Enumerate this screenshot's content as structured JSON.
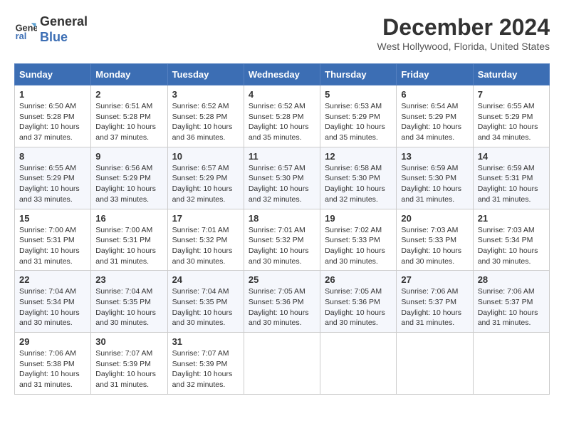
{
  "logo": {
    "line1": "General",
    "line2": "Blue"
  },
  "title": "December 2024",
  "location": "West Hollywood, Florida, United States",
  "days_of_week": [
    "Sunday",
    "Monday",
    "Tuesday",
    "Wednesday",
    "Thursday",
    "Friday",
    "Saturday"
  ],
  "weeks": [
    [
      {
        "day": "1",
        "sunrise": "6:50 AM",
        "sunset": "5:28 PM",
        "daylight": "10 hours and 37 minutes."
      },
      {
        "day": "2",
        "sunrise": "6:51 AM",
        "sunset": "5:28 PM",
        "daylight": "10 hours and 37 minutes."
      },
      {
        "day": "3",
        "sunrise": "6:52 AM",
        "sunset": "5:28 PM",
        "daylight": "10 hours and 36 minutes."
      },
      {
        "day": "4",
        "sunrise": "6:52 AM",
        "sunset": "5:28 PM",
        "daylight": "10 hours and 35 minutes."
      },
      {
        "day": "5",
        "sunrise": "6:53 AM",
        "sunset": "5:29 PM",
        "daylight": "10 hours and 35 minutes."
      },
      {
        "day": "6",
        "sunrise": "6:54 AM",
        "sunset": "5:29 PM",
        "daylight": "10 hours and 34 minutes."
      },
      {
        "day": "7",
        "sunrise": "6:55 AM",
        "sunset": "5:29 PM",
        "daylight": "10 hours and 34 minutes."
      }
    ],
    [
      {
        "day": "8",
        "sunrise": "6:55 AM",
        "sunset": "5:29 PM",
        "daylight": "10 hours and 33 minutes."
      },
      {
        "day": "9",
        "sunrise": "6:56 AM",
        "sunset": "5:29 PM",
        "daylight": "10 hours and 33 minutes."
      },
      {
        "day": "10",
        "sunrise": "6:57 AM",
        "sunset": "5:29 PM",
        "daylight": "10 hours and 32 minutes."
      },
      {
        "day": "11",
        "sunrise": "6:57 AM",
        "sunset": "5:30 PM",
        "daylight": "10 hours and 32 minutes."
      },
      {
        "day": "12",
        "sunrise": "6:58 AM",
        "sunset": "5:30 PM",
        "daylight": "10 hours and 32 minutes."
      },
      {
        "day": "13",
        "sunrise": "6:59 AM",
        "sunset": "5:30 PM",
        "daylight": "10 hours and 31 minutes."
      },
      {
        "day": "14",
        "sunrise": "6:59 AM",
        "sunset": "5:31 PM",
        "daylight": "10 hours and 31 minutes."
      }
    ],
    [
      {
        "day": "15",
        "sunrise": "7:00 AM",
        "sunset": "5:31 PM",
        "daylight": "10 hours and 31 minutes."
      },
      {
        "day": "16",
        "sunrise": "7:00 AM",
        "sunset": "5:31 PM",
        "daylight": "10 hours and 31 minutes."
      },
      {
        "day": "17",
        "sunrise": "7:01 AM",
        "sunset": "5:32 PM",
        "daylight": "10 hours and 30 minutes."
      },
      {
        "day": "18",
        "sunrise": "7:01 AM",
        "sunset": "5:32 PM",
        "daylight": "10 hours and 30 minutes."
      },
      {
        "day": "19",
        "sunrise": "7:02 AM",
        "sunset": "5:33 PM",
        "daylight": "10 hours and 30 minutes."
      },
      {
        "day": "20",
        "sunrise": "7:03 AM",
        "sunset": "5:33 PM",
        "daylight": "10 hours and 30 minutes."
      },
      {
        "day": "21",
        "sunrise": "7:03 AM",
        "sunset": "5:34 PM",
        "daylight": "10 hours and 30 minutes."
      }
    ],
    [
      {
        "day": "22",
        "sunrise": "7:04 AM",
        "sunset": "5:34 PM",
        "daylight": "10 hours and 30 minutes."
      },
      {
        "day": "23",
        "sunrise": "7:04 AM",
        "sunset": "5:35 PM",
        "daylight": "10 hours and 30 minutes."
      },
      {
        "day": "24",
        "sunrise": "7:04 AM",
        "sunset": "5:35 PM",
        "daylight": "10 hours and 30 minutes."
      },
      {
        "day": "25",
        "sunrise": "7:05 AM",
        "sunset": "5:36 PM",
        "daylight": "10 hours and 30 minutes."
      },
      {
        "day": "26",
        "sunrise": "7:05 AM",
        "sunset": "5:36 PM",
        "daylight": "10 hours and 30 minutes."
      },
      {
        "day": "27",
        "sunrise": "7:06 AM",
        "sunset": "5:37 PM",
        "daylight": "10 hours and 31 minutes."
      },
      {
        "day": "28",
        "sunrise": "7:06 AM",
        "sunset": "5:37 PM",
        "daylight": "10 hours and 31 minutes."
      }
    ],
    [
      {
        "day": "29",
        "sunrise": "7:06 AM",
        "sunset": "5:38 PM",
        "daylight": "10 hours and 31 minutes."
      },
      {
        "day": "30",
        "sunrise": "7:07 AM",
        "sunset": "5:39 PM",
        "daylight": "10 hours and 31 minutes."
      },
      {
        "day": "31",
        "sunrise": "7:07 AM",
        "sunset": "5:39 PM",
        "daylight": "10 hours and 32 minutes."
      },
      null,
      null,
      null,
      null
    ]
  ]
}
